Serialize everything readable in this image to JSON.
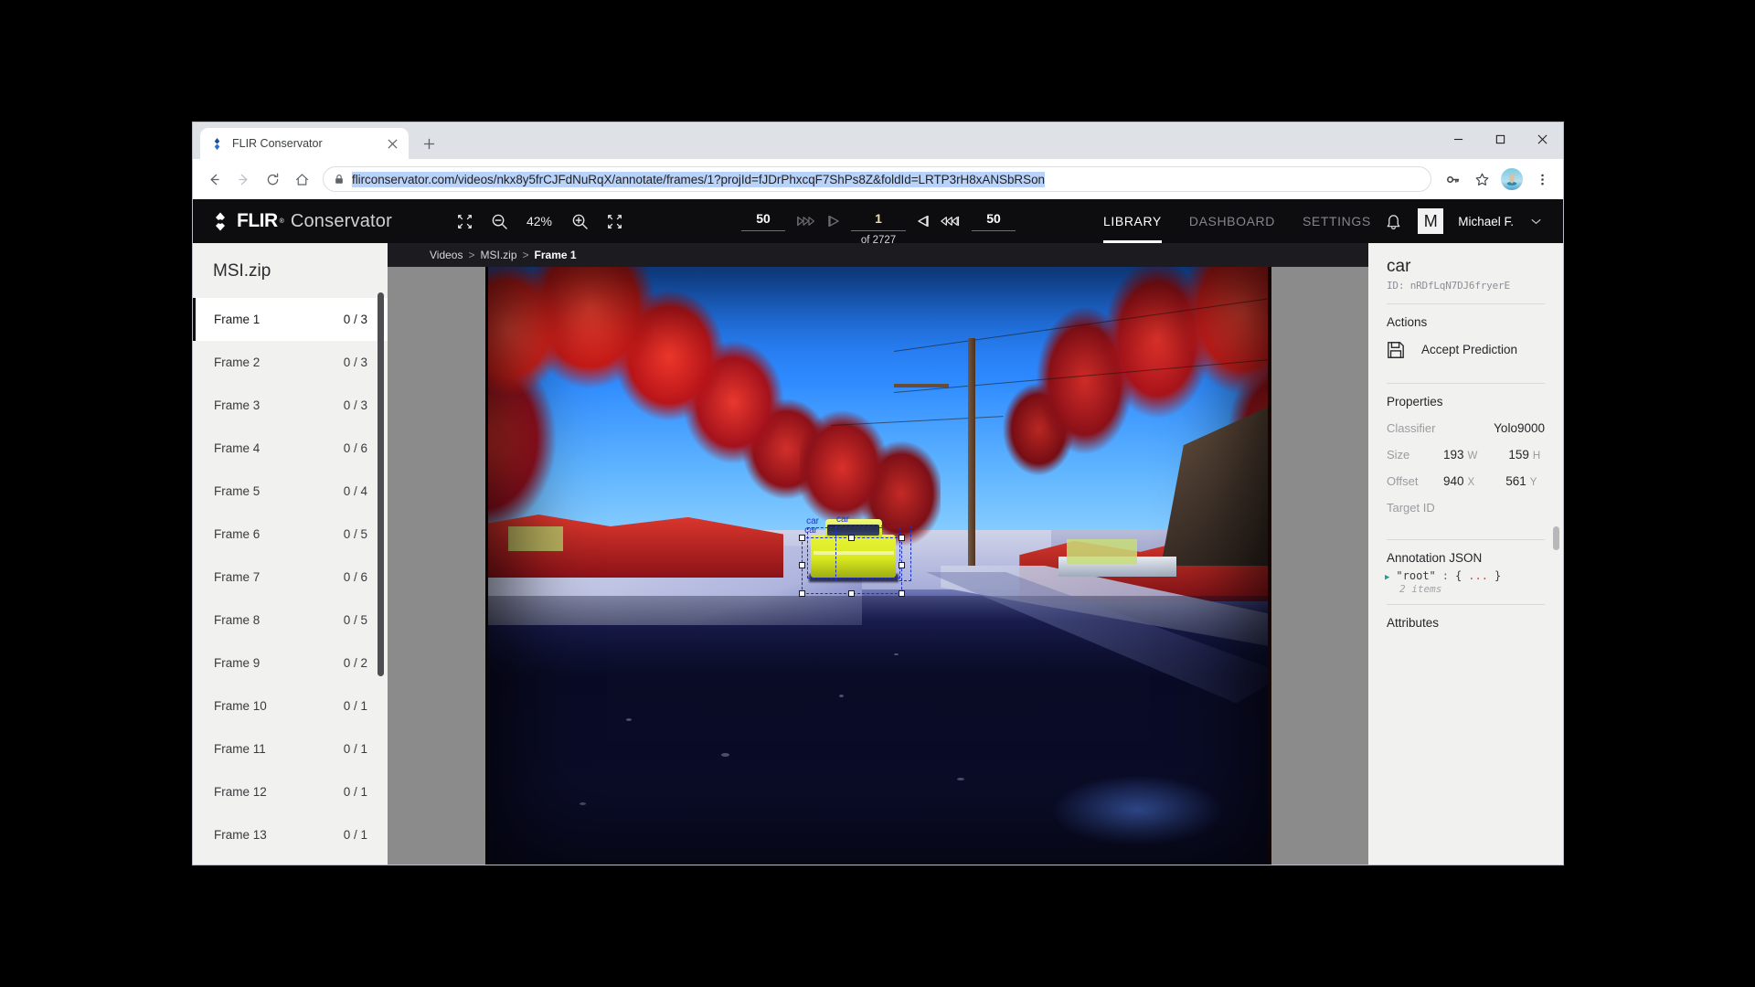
{
  "browser": {
    "tab": {
      "title": "FLIR Conservator",
      "favicon_icon": "flir-diamond-icon",
      "close_icon": "close-icon"
    },
    "new_tab_label": "+",
    "window_controls": {
      "minimize": "minimize-icon",
      "maximize": "maximize-icon",
      "close": "close-icon"
    },
    "nav": {
      "back": "back-arrow-icon",
      "forward": "forward-arrow-icon",
      "reload": "reload-icon",
      "home": "home-icon"
    },
    "url": "flirconservator.com/videos/nkx8y5frCJFdNuRqX/annotate/frames/1?projId=fJDrPhxcqF7ShPs8Z&foldId=LRTP3rH8xANSbRSon",
    "lock_icon": "lock-icon",
    "toolbar_right": {
      "key_icon": "key-icon",
      "bookmark_icon": "star-icon",
      "profile_icon": "profile-avatar-icon",
      "menu_icon": "three-dots-menu-icon"
    }
  },
  "app": {
    "brand": {
      "flir": "FLIR",
      "tm": "®",
      "conservator": "Conservator"
    },
    "zoom": {
      "fit_icon": "fit-to-screen-icon",
      "zoom_out_icon": "zoom-out-icon",
      "level": "42%",
      "zoom_in_icon": "zoom-in-icon",
      "fullscreen_icon": "fullscreen-icon"
    },
    "frame_nav": {
      "skip_back_value": "50",
      "jump_back_icon": "skip-back-multiple-icon",
      "prev_icon": "previous-frame-icon",
      "current_frame": "1",
      "total_label": "of 2727",
      "next_icon": "next-frame-icon",
      "jump_fwd_icon": "skip-forward-multiple-icon",
      "skip_fwd_value": "50"
    },
    "main_nav": [
      {
        "label": "LIBRARY",
        "active": true
      },
      {
        "label": "DASHBOARD",
        "active": false
      },
      {
        "label": "SETTINGS",
        "active": false
      }
    ],
    "header_right": {
      "bell_icon": "notification-bell-icon",
      "avatar_initial": "M",
      "user_name": "Michael F.",
      "caret_icon": "chevron-down-icon"
    }
  },
  "sidebar": {
    "title": "MSI.zip",
    "frames": [
      {
        "label": "Frame 1",
        "count": "0 / 3",
        "selected": true
      },
      {
        "label": "Frame 2",
        "count": "0 / 3",
        "selected": false
      },
      {
        "label": "Frame 3",
        "count": "0 / 3",
        "selected": false
      },
      {
        "label": "Frame 4",
        "count": "0 / 6",
        "selected": false
      },
      {
        "label": "Frame 5",
        "count": "0 / 4",
        "selected": false
      },
      {
        "label": "Frame 6",
        "count": "0 / 5",
        "selected": false
      },
      {
        "label": "Frame 7",
        "count": "0 / 6",
        "selected": false
      },
      {
        "label": "Frame 8",
        "count": "0 / 5",
        "selected": false
      },
      {
        "label": "Frame 9",
        "count": "0 / 2",
        "selected": false
      },
      {
        "label": "Frame 10",
        "count": "0 / 1",
        "selected": false
      },
      {
        "label": "Frame 11",
        "count": "0 / 1",
        "selected": false
      },
      {
        "label": "Frame 12",
        "count": "0 / 1",
        "selected": false
      },
      {
        "label": "Frame 13",
        "count": "0 / 1",
        "selected": false
      }
    ]
  },
  "breadcrumb": {
    "root": "Videos",
    "sep1": ">",
    "folder": "MSI.zip",
    "sep2": ">",
    "current": "Frame 1"
  },
  "canvas": {
    "annotations": [
      {
        "label": "car",
        "selected": true
      },
      {
        "label": "car",
        "selected": false
      },
      {
        "label": "car",
        "selected": false
      }
    ],
    "box_color": "#1b2fd0"
  },
  "right_panel": {
    "title": "car",
    "id_label": "ID: nRDfLqN7DJ6fryerE",
    "actions_heading": "Actions",
    "accept_prediction": {
      "label": "Accept Prediction",
      "icon": "save-floppy-icon"
    },
    "properties_heading": "Properties",
    "properties": [
      {
        "key": "Classifier",
        "value": "Yolo9000"
      }
    ],
    "size": {
      "key": "Size",
      "w_value": "193",
      "w_unit": "W",
      "h_value": "159",
      "h_unit": "H"
    },
    "offset": {
      "key": "Offset",
      "x_value": "940",
      "x_unit": "X",
      "y_value": "561",
      "y_unit": "Y"
    },
    "target_id": {
      "key": "Target ID",
      "value": ""
    },
    "annotation_json_heading": "Annotation JSON",
    "json": {
      "triangle": "▶",
      "key": "\"root\"",
      "colon": ":",
      "open": "{",
      "dots": "...",
      "close": "}",
      "items": "2 items"
    },
    "attributes_heading": "Attributes"
  }
}
